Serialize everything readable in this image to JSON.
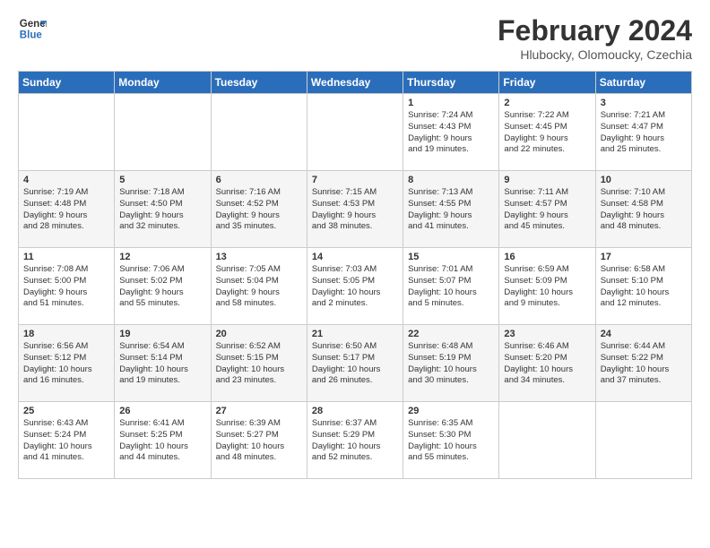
{
  "header": {
    "logo_line1": "General",
    "logo_line2": "Blue",
    "month": "February 2024",
    "location": "Hlubocky, Olomoucky, Czechia"
  },
  "days_of_week": [
    "Sunday",
    "Monday",
    "Tuesday",
    "Wednesday",
    "Thursday",
    "Friday",
    "Saturday"
  ],
  "weeks": [
    [
      {
        "day": "",
        "content": ""
      },
      {
        "day": "",
        "content": ""
      },
      {
        "day": "",
        "content": ""
      },
      {
        "day": "",
        "content": ""
      },
      {
        "day": "1",
        "content": "Sunrise: 7:24 AM\nSunset: 4:43 PM\nDaylight: 9 hours\nand 19 minutes."
      },
      {
        "day": "2",
        "content": "Sunrise: 7:22 AM\nSunset: 4:45 PM\nDaylight: 9 hours\nand 22 minutes."
      },
      {
        "day": "3",
        "content": "Sunrise: 7:21 AM\nSunset: 4:47 PM\nDaylight: 9 hours\nand 25 minutes."
      }
    ],
    [
      {
        "day": "4",
        "content": "Sunrise: 7:19 AM\nSunset: 4:48 PM\nDaylight: 9 hours\nand 28 minutes."
      },
      {
        "day": "5",
        "content": "Sunrise: 7:18 AM\nSunset: 4:50 PM\nDaylight: 9 hours\nand 32 minutes."
      },
      {
        "day": "6",
        "content": "Sunrise: 7:16 AM\nSunset: 4:52 PM\nDaylight: 9 hours\nand 35 minutes."
      },
      {
        "day": "7",
        "content": "Sunrise: 7:15 AM\nSunset: 4:53 PM\nDaylight: 9 hours\nand 38 minutes."
      },
      {
        "day": "8",
        "content": "Sunrise: 7:13 AM\nSunset: 4:55 PM\nDaylight: 9 hours\nand 41 minutes."
      },
      {
        "day": "9",
        "content": "Sunrise: 7:11 AM\nSunset: 4:57 PM\nDaylight: 9 hours\nand 45 minutes."
      },
      {
        "day": "10",
        "content": "Sunrise: 7:10 AM\nSunset: 4:58 PM\nDaylight: 9 hours\nand 48 minutes."
      }
    ],
    [
      {
        "day": "11",
        "content": "Sunrise: 7:08 AM\nSunset: 5:00 PM\nDaylight: 9 hours\nand 51 minutes."
      },
      {
        "day": "12",
        "content": "Sunrise: 7:06 AM\nSunset: 5:02 PM\nDaylight: 9 hours\nand 55 minutes."
      },
      {
        "day": "13",
        "content": "Sunrise: 7:05 AM\nSunset: 5:04 PM\nDaylight: 9 hours\nand 58 minutes."
      },
      {
        "day": "14",
        "content": "Sunrise: 7:03 AM\nSunset: 5:05 PM\nDaylight: 10 hours\nand 2 minutes."
      },
      {
        "day": "15",
        "content": "Sunrise: 7:01 AM\nSunset: 5:07 PM\nDaylight: 10 hours\nand 5 minutes."
      },
      {
        "day": "16",
        "content": "Sunrise: 6:59 AM\nSunset: 5:09 PM\nDaylight: 10 hours\nand 9 minutes."
      },
      {
        "day": "17",
        "content": "Sunrise: 6:58 AM\nSunset: 5:10 PM\nDaylight: 10 hours\nand 12 minutes."
      }
    ],
    [
      {
        "day": "18",
        "content": "Sunrise: 6:56 AM\nSunset: 5:12 PM\nDaylight: 10 hours\nand 16 minutes."
      },
      {
        "day": "19",
        "content": "Sunrise: 6:54 AM\nSunset: 5:14 PM\nDaylight: 10 hours\nand 19 minutes."
      },
      {
        "day": "20",
        "content": "Sunrise: 6:52 AM\nSunset: 5:15 PM\nDaylight: 10 hours\nand 23 minutes."
      },
      {
        "day": "21",
        "content": "Sunrise: 6:50 AM\nSunset: 5:17 PM\nDaylight: 10 hours\nand 26 minutes."
      },
      {
        "day": "22",
        "content": "Sunrise: 6:48 AM\nSunset: 5:19 PM\nDaylight: 10 hours\nand 30 minutes."
      },
      {
        "day": "23",
        "content": "Sunrise: 6:46 AM\nSunset: 5:20 PM\nDaylight: 10 hours\nand 34 minutes."
      },
      {
        "day": "24",
        "content": "Sunrise: 6:44 AM\nSunset: 5:22 PM\nDaylight: 10 hours\nand 37 minutes."
      }
    ],
    [
      {
        "day": "25",
        "content": "Sunrise: 6:43 AM\nSunset: 5:24 PM\nDaylight: 10 hours\nand 41 minutes."
      },
      {
        "day": "26",
        "content": "Sunrise: 6:41 AM\nSunset: 5:25 PM\nDaylight: 10 hours\nand 44 minutes."
      },
      {
        "day": "27",
        "content": "Sunrise: 6:39 AM\nSunset: 5:27 PM\nDaylight: 10 hours\nand 48 minutes."
      },
      {
        "day": "28",
        "content": "Sunrise: 6:37 AM\nSunset: 5:29 PM\nDaylight: 10 hours\nand 52 minutes."
      },
      {
        "day": "29",
        "content": "Sunrise: 6:35 AM\nSunset: 5:30 PM\nDaylight: 10 hours\nand 55 minutes."
      },
      {
        "day": "",
        "content": ""
      },
      {
        "day": "",
        "content": ""
      }
    ]
  ]
}
